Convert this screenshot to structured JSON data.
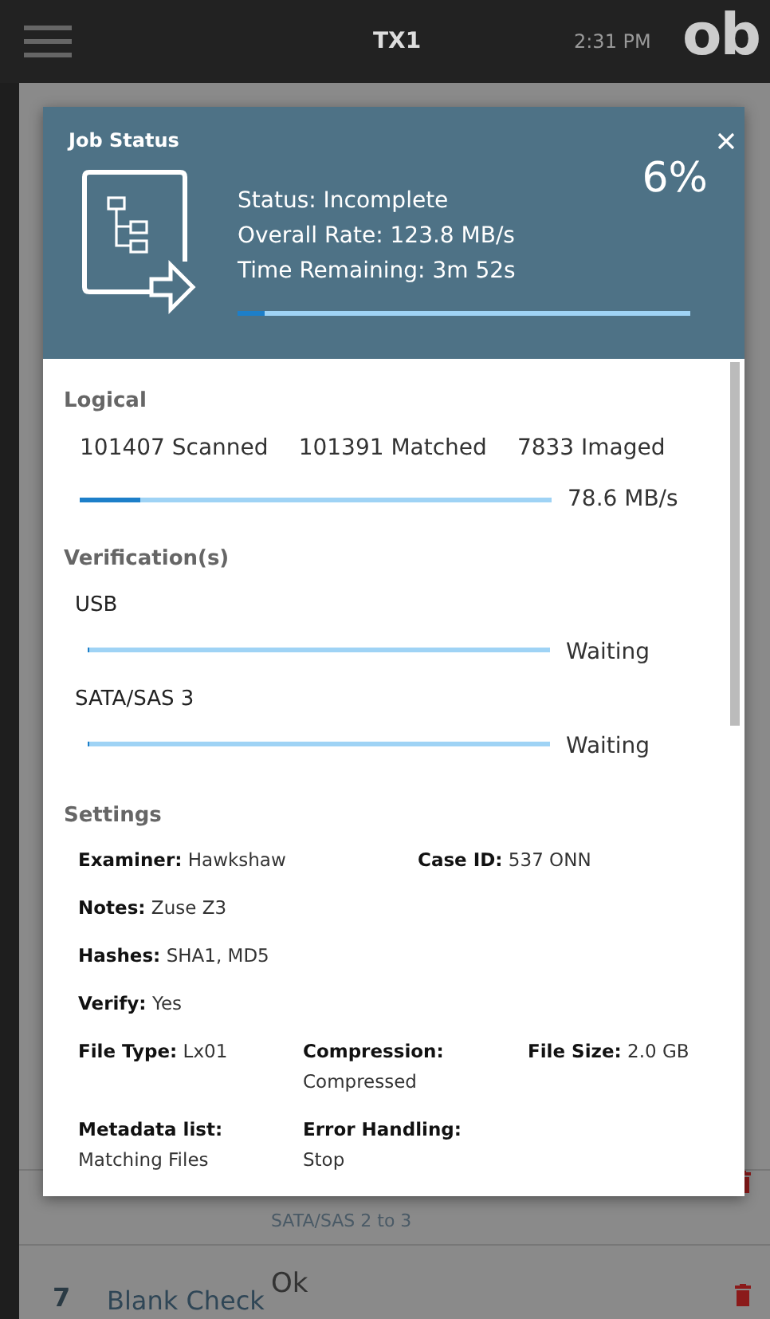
{
  "top_bar": {
    "title": "TX1",
    "time": "2:31 PM",
    "logo": "ob"
  },
  "background_rows": [
    {
      "number": null,
      "name": null,
      "status": null,
      "detail": "SATA/SAS 2 to 3"
    },
    {
      "number": "7",
      "name": "Blank Check",
      "status": "Ok",
      "detail": null
    }
  ],
  "job_status": {
    "title": "Job Status",
    "percent": "6%",
    "lines": [
      "Status: Incomplete",
      "Overall Rate: 123.8 MB/s",
      "Time Remaining: 3m 52s"
    ],
    "level": 0.06,
    "logical": {
      "heading": "Logical",
      "counts": [
        "101407 Scanned",
        "101391 Matched",
        "7833 Imaged"
      ],
      "level": 0.13,
      "rate": "78.6 MB/s"
    },
    "verifications": {
      "heading": "Verification(s)",
      "items": [
        {
          "name": "USB",
          "level": 0,
          "state": "Waiting"
        },
        {
          "name": "SATA/SAS 3",
          "level": 0,
          "state": "Waiting"
        }
      ]
    },
    "settings": {
      "heading": "Settings",
      "rows": [
        [
          "**Examiner:** Hawkshaw",
          "**Case ID:** 537 ONN"
        ],
        [
          "**Notes:** Zuse Z3"
        ],
        [
          "**Hashes:** SHA1, MD5"
        ],
        [
          "**Verify:** Yes"
        ],
        [
          "**File Type:** Lx01",
          "**Compression:** Compressed",
          "**File Size:** 2.0 GB"
        ],
        [
          "**Metadata list:** Matching Files",
          "**Error Handling:** Stop"
        ]
      ]
    }
  }
}
